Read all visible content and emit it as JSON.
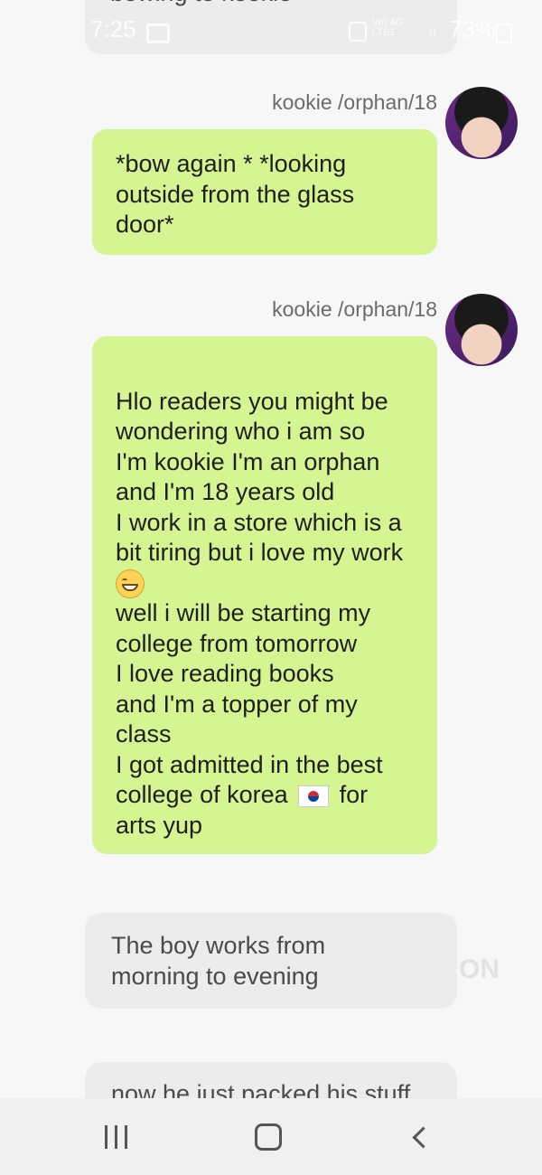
{
  "status_bar": {
    "time": "7:25",
    "network": "Vo) 4G\nLTE1",
    "battery": "73%"
  },
  "messages": [
    {
      "type": "narration",
      "text": "after she pays she left after\nbowing to kookie"
    },
    {
      "type": "character",
      "sender": "kookie /orphan/18",
      "text": "*bow again * *looking outside from the glass door*"
    },
    {
      "type": "character",
      "sender": "kookie /orphan/18",
      "text_a": "Hlo readers you might be wondering who i am so\nI'm kookie I'm an orphan and I'm 18 years old\nI work in a store which is a bit tiring but i love my work",
      "text_b": "well i will be starting my college from tomorrow\nI love reading books\nand I'm a topper of my class\nI got admitted in the best college of korea",
      "text_c": "for arts yup",
      "emoji_1": "grinning-face",
      "emoji_2": "south-korea-flag"
    },
    {
      "type": "narration",
      "text": "The boy works from\nmorning to evening"
    },
    {
      "type": "narration",
      "text": "now he just packed his stuff"
    }
  ],
  "watermark": "ON",
  "nav": {
    "recent": "recent-apps",
    "home": "home",
    "back": "back"
  }
}
